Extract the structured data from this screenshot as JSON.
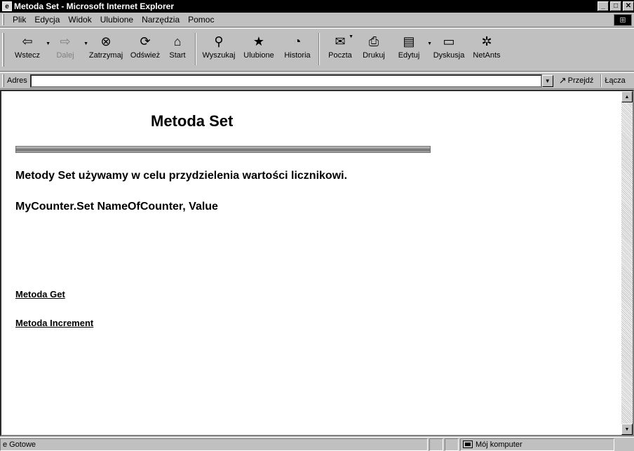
{
  "window": {
    "title": "Metoda Set - Microsoft Internet Explorer"
  },
  "menu": [
    "Plik",
    "Edycja",
    "Widok",
    "Ulubione",
    "Narzędzia",
    "Pomoc"
  ],
  "toolbar": {
    "back": "Wstecz",
    "forward": "Dalej",
    "stop": "Zatrzymaj",
    "refresh": "Odśwież",
    "home": "Start",
    "search": "Wyszukaj",
    "favorites": "Ulubione",
    "history": "Historia",
    "mail": "Poczta",
    "print": "Drukuj",
    "edit": "Edytuj",
    "discuss": "Dyskusja",
    "netants": "NetAnts"
  },
  "address": {
    "label": "Adres",
    "value": "",
    "go": "Przejdź",
    "links": "Łącza"
  },
  "page": {
    "title": "Metoda Set",
    "description": "Metody Set używamy w celu przydzielenia wartości licznikowi.",
    "syntax": "MyCounter.Set NameOfCounter, Value",
    "link_get": "Metoda Get",
    "link_increment": "Metoda Increment"
  },
  "status": {
    "text": "Gotowe",
    "zone": "Mój komputer"
  }
}
